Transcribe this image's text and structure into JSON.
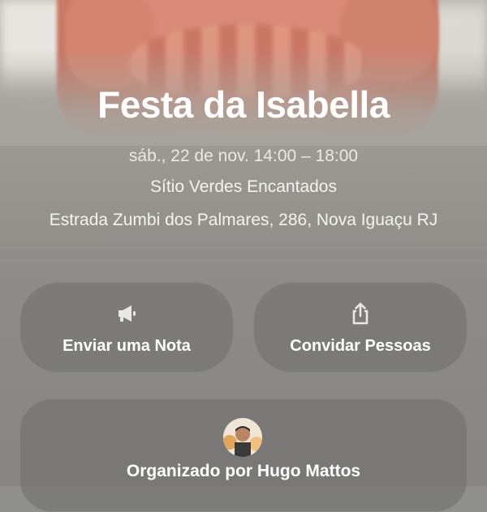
{
  "event": {
    "title": "Festa da Isabella",
    "datetime": "sáb., 22 de nov. 14:00 – 18:00",
    "venue": "Sítio Verdes Encantados",
    "address": "Estrada Zumbi dos Palmares, 286, Nova Iguaçu RJ"
  },
  "actions": {
    "send_note": {
      "label": "Enviar uma Nota",
      "icon": "megaphone-icon"
    },
    "invite": {
      "label": "Convidar Pessoas",
      "icon": "share-icon"
    }
  },
  "organizer": {
    "label": "Organizado por Hugo Mattos",
    "avatar": "organizer-avatar"
  }
}
